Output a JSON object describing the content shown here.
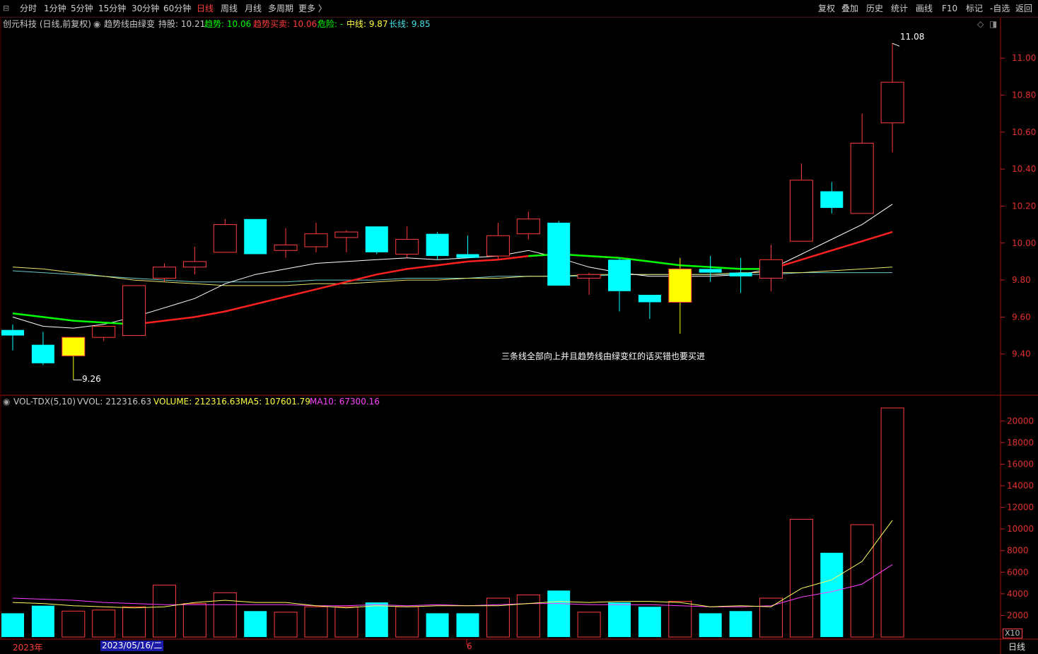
{
  "toolbar": {
    "left": [
      "分时",
      "1分钟",
      "5分钟",
      "15分钟",
      "30分钟",
      "60分钟",
      "日线",
      "周线",
      "月线",
      "多周期",
      "更多 〉"
    ],
    "active": "日线",
    "right": [
      "复权",
      "叠加",
      "历史",
      "统计",
      "画线",
      "F10",
      "标记",
      "-自选",
      "返回"
    ]
  },
  "legend": {
    "stock": "创元科技 (日线,前复权)",
    "indicator": "趋势线由绿变",
    "hold": "持股: 10.21",
    "trend": "趋势: 10.06",
    "trade": "趋势买卖: 10.06",
    "danger": "危险: -",
    "mid": "中线: 9.87",
    "long": "长线: 9.85"
  },
  "vol_legend": {
    "name": "VOL-TDX(5,10)",
    "vvol": "VVOL: 212316.63",
    "volume": "VOLUME: 212316.63",
    "ma5": "MA5: 107601.79",
    "ma10": "MA10: 67300.16"
  },
  "annotations": {
    "note": "三条线全部向上并且趋势线由绿变红的话买错也要买进",
    "high": "11.08",
    "low": "9.26"
  },
  "bottom": {
    "year": "2023年",
    "date": "2023/05/16/二",
    "month": "6",
    "period": "日线",
    "scale": "X10"
  },
  "colors": {
    "up": "#ff3c3c",
    "down": "#00ffff",
    "special": "#ffff00",
    "trend_green": "#00ff00",
    "trend_red": "#ff2020",
    "mid": "#ffffff",
    "long": "#e8e870",
    "long2": "#6ec8c8",
    "ma5": "#ffff60",
    "ma10": "#ff40ff"
  },
  "chart_data": [
    {
      "type": "candlestick",
      "ylim": [
        9.2,
        11.15
      ],
      "yticks": [
        "9.40",
        "9.60",
        "9.80",
        "10.00",
        "10.20",
        "10.40",
        "10.60",
        "10.80",
        "11.00"
      ],
      "candles": [
        {
          "o": 9.53,
          "h": 9.56,
          "l": 9.42,
          "c": 9.5,
          "kind": "down"
        },
        {
          "o": 9.45,
          "h": 9.52,
          "l": 9.34,
          "c": 9.35,
          "kind": "down"
        },
        {
          "o": 9.39,
          "h": 9.49,
          "l": 9.26,
          "c": 9.49,
          "kind": "special"
        },
        {
          "o": 9.49,
          "h": 9.55,
          "l": 9.47,
          "c": 9.55,
          "kind": "up"
        },
        {
          "o": 9.5,
          "h": 9.77,
          "l": 9.5,
          "c": 9.77,
          "kind": "up"
        },
        {
          "o": 9.81,
          "h": 9.89,
          "l": 9.79,
          "c": 9.87,
          "kind": "up"
        },
        {
          "o": 9.87,
          "h": 9.98,
          "l": 9.83,
          "c": 9.9,
          "kind": "up"
        },
        {
          "o": 9.95,
          "h": 10.13,
          "l": 9.95,
          "c": 10.1,
          "kind": "up"
        },
        {
          "o": 10.13,
          "h": 10.13,
          "l": 9.94,
          "c": 9.94,
          "kind": "down"
        },
        {
          "o": 9.96,
          "h": 10.08,
          "l": 9.92,
          "c": 9.99,
          "kind": "up"
        },
        {
          "o": 9.98,
          "h": 10.11,
          "l": 9.95,
          "c": 10.05,
          "kind": "up"
        },
        {
          "o": 10.03,
          "h": 10.07,
          "l": 9.95,
          "c": 10.06,
          "kind": "up"
        },
        {
          "o": 10.09,
          "h": 10.09,
          "l": 9.94,
          "c": 9.95,
          "kind": "down"
        },
        {
          "o": 9.94,
          "h": 10.09,
          "l": 9.92,
          "c": 10.02,
          "kind": "up"
        },
        {
          "o": 10.05,
          "h": 10.06,
          "l": 9.91,
          "c": 9.93,
          "kind": "down"
        },
        {
          "o": 9.94,
          "h": 10.04,
          "l": 9.92,
          "c": 9.92,
          "kind": "down"
        },
        {
          "o": 9.93,
          "h": 10.11,
          "l": 9.91,
          "c": 10.04,
          "kind": "up"
        },
        {
          "o": 10.05,
          "h": 10.17,
          "l": 10.02,
          "c": 10.13,
          "kind": "up"
        },
        {
          "o": 10.11,
          "h": 10.12,
          "l": 9.78,
          "c": 9.77,
          "kind": "down"
        },
        {
          "o": 9.81,
          "h": 9.84,
          "l": 9.72,
          "c": 9.83,
          "kind": "up"
        },
        {
          "o": 9.91,
          "h": 9.92,
          "l": 9.63,
          "c": 9.74,
          "kind": "down"
        },
        {
          "o": 9.72,
          "h": 9.72,
          "l": 9.59,
          "c": 9.68,
          "kind": "down"
        },
        {
          "o": 9.68,
          "h": 9.92,
          "l": 9.51,
          "c": 9.86,
          "kind": "special"
        },
        {
          "o": 9.86,
          "h": 9.93,
          "l": 9.79,
          "c": 9.84,
          "kind": "down"
        },
        {
          "o": 9.84,
          "h": 9.92,
          "l": 9.73,
          "c": 9.82,
          "kind": "down"
        },
        {
          "o": 9.81,
          "h": 9.99,
          "l": 9.74,
          "c": 9.91,
          "kind": "up"
        },
        {
          "o": 10.01,
          "h": 10.43,
          "l": 10.01,
          "c": 10.34,
          "kind": "up"
        },
        {
          "o": 10.28,
          "h": 10.33,
          "l": 10.16,
          "c": 10.19,
          "kind": "down"
        },
        {
          "o": 10.16,
          "h": 10.7,
          "l": 10.16,
          "c": 10.54,
          "kind": "up"
        },
        {
          "o": 10.65,
          "h": 11.08,
          "l": 10.49,
          "c": 10.87,
          "kind": "up"
        }
      ],
      "trend_line": [
        9.62,
        9.6,
        9.58,
        9.57,
        9.56,
        9.58,
        9.6,
        9.63,
        9.67,
        9.71,
        9.75,
        9.79,
        9.83,
        9.86,
        9.88,
        9.9,
        9.91,
        9.93,
        9.94,
        9.93,
        9.92,
        9.9,
        9.88,
        9.87,
        9.86,
        9.86,
        9.91,
        9.96,
        10.01,
        10.06
      ],
      "trend_red_from": 4,
      "mid_line": [
        9.6,
        9.55,
        9.54,
        9.56,
        9.6,
        9.65,
        9.7,
        9.78,
        9.83,
        9.86,
        9.89,
        9.9,
        9.91,
        9.92,
        9.91,
        9.92,
        9.93,
        9.96,
        9.92,
        9.87,
        9.84,
        9.82,
        9.82,
        9.82,
        9.83,
        9.86,
        9.94,
        10.02,
        10.1,
        10.21
      ],
      "long_line": [
        9.87,
        9.86,
        9.84,
        9.82,
        9.8,
        9.79,
        9.78,
        9.77,
        9.77,
        9.77,
        9.78,
        9.78,
        9.79,
        9.8,
        9.8,
        9.81,
        9.81,
        9.82,
        9.82,
        9.83,
        9.83,
        9.83,
        9.83,
        9.83,
        9.84,
        9.84,
        9.84,
        9.85,
        9.86,
        9.87
      ],
      "long2_line": [
        9.85,
        9.84,
        9.83,
        9.82,
        9.81,
        9.8,
        9.79,
        9.79,
        9.79,
        9.79,
        9.8,
        9.8,
        9.8,
        9.81,
        9.81,
        9.81,
        9.82,
        9.82,
        9.82,
        9.82,
        9.83,
        9.83,
        9.83,
        9.83,
        9.83,
        9.83,
        9.84,
        9.84,
        9.84,
        9.84
      ]
    },
    {
      "type": "bar",
      "unit": "X10",
      "ylim": [
        0,
        21200
      ],
      "yticks": [
        "2000",
        "4000",
        "6000",
        "8000",
        "10000",
        "12000",
        "14000",
        "16000",
        "18000",
        "20000"
      ],
      "volumes": [
        2200,
        2900,
        2400,
        2500,
        2800,
        4800,
        3100,
        4100,
        2400,
        2300,
        2800,
        2800,
        3200,
        2800,
        2200,
        2200,
        3600,
        3900,
        4300,
        2300,
        3200,
        2800,
        3300,
        2200,
        2400,
        3600,
        10900,
        7800,
        10400,
        21200
      ],
      "ma5": [
        3200,
        3100,
        2900,
        2800,
        2700,
        2800,
        3200,
        3400,
        3200,
        3200,
        2900,
        2700,
        2900,
        2800,
        2900,
        2900,
        2900,
        3100,
        3300,
        3200,
        3300,
        3300,
        3200,
        2800,
        2900,
        2800,
        4500,
        5300,
        7000,
        10800
      ],
      "ma10": [
        3600,
        3500,
        3400,
        3200,
        3100,
        3000,
        3000,
        3000,
        3000,
        3000,
        2900,
        2900,
        3000,
        2900,
        3000,
        2900,
        3000,
        3100,
        3100,
        3000,
        3000,
        3000,
        2900,
        2800,
        2800,
        2900,
        3700,
        4200,
        4900,
        6700
      ]
    }
  ]
}
